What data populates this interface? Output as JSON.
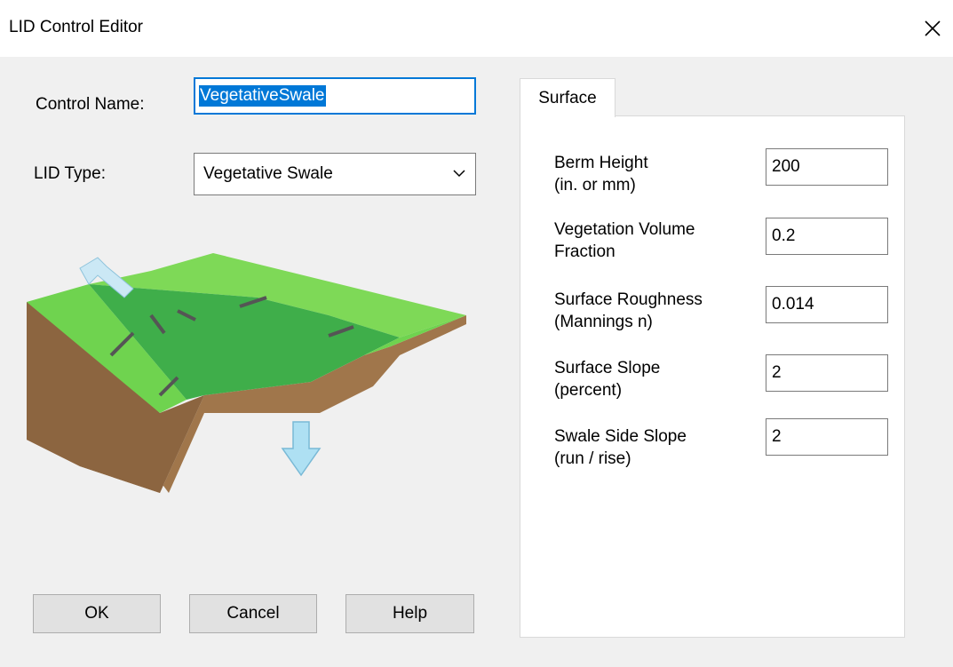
{
  "window": {
    "title": "LID Control Editor"
  },
  "control_name": {
    "label": "Control Name:",
    "value": "VegetativeSwale"
  },
  "lid_type": {
    "label": "LID Type:",
    "selected": "Vegetative Swale"
  },
  "buttons": {
    "ok": "OK",
    "cancel": "Cancel",
    "help": "Help"
  },
  "tab": {
    "label": "Surface"
  },
  "params": [
    {
      "line1": "Berm Height",
      "line2": "(in. or mm)",
      "value": "200"
    },
    {
      "line1": "Vegetation Volume",
      "line2": "Fraction",
      "value": "0.2"
    },
    {
      "line1": "Surface Roughness",
      "line2": "(Mannings n)",
      "value": "0.014"
    },
    {
      "line1": "Surface Slope",
      "line2": "(percent)",
      "value": "2"
    },
    {
      "line1": "Swale Side Slope",
      "line2": "(run / rise)",
      "value": "2"
    }
  ],
  "icons": {
    "close": "close-icon",
    "dropdown": "chevron-down-icon",
    "illustration": "vegetative-swale-illustration"
  },
  "colors": {
    "accent": "#0078d7",
    "grass_light": "#7ed957",
    "grass_dark": "#3fae4a",
    "soil": "#a0764b"
  }
}
